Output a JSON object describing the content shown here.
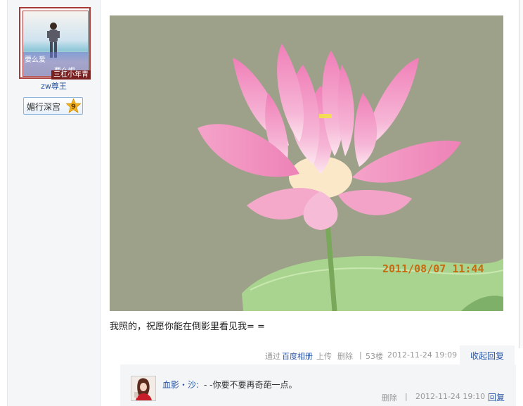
{
  "author": {
    "avatar_text_1": "要么爱",
    "avatar_text_2": "要么恨",
    "avatar_tag": "三杠小年青",
    "username": "zw尊王",
    "badge_label": "媚行深宫",
    "badge_level": "9"
  },
  "post": {
    "photo_timestamp": "2011/08/07 11:44",
    "text": "我照的，祝愿你能在倒影里看见我= ="
  },
  "post_meta": {
    "via_prefix": "通过",
    "via_link": "百度相册",
    "via_suffix": "上传",
    "delete": "删除",
    "sep": "|",
    "floor": "53楼",
    "datetime": "2012-11-24 19:09",
    "collapse_reply": "收起回复"
  },
  "reply": {
    "username": "血影・沙:",
    "text": "- -你要不要再奇葩一点。",
    "delete": "删除",
    "sep": "|",
    "datetime": "2012-11-24 19:10",
    "reply_label": "回复"
  },
  "colors": {
    "link": "#2a56a6",
    "avatar_border": "#a83a3a",
    "badge_level": "#f2b21b",
    "photo_background": "#9fa28a",
    "lotus_petal": "#f29ac4",
    "leaf": "#9fce86",
    "timestamp_text": "#c86a10"
  },
  "icons": {
    "badge_level_icon": "star-icon"
  }
}
